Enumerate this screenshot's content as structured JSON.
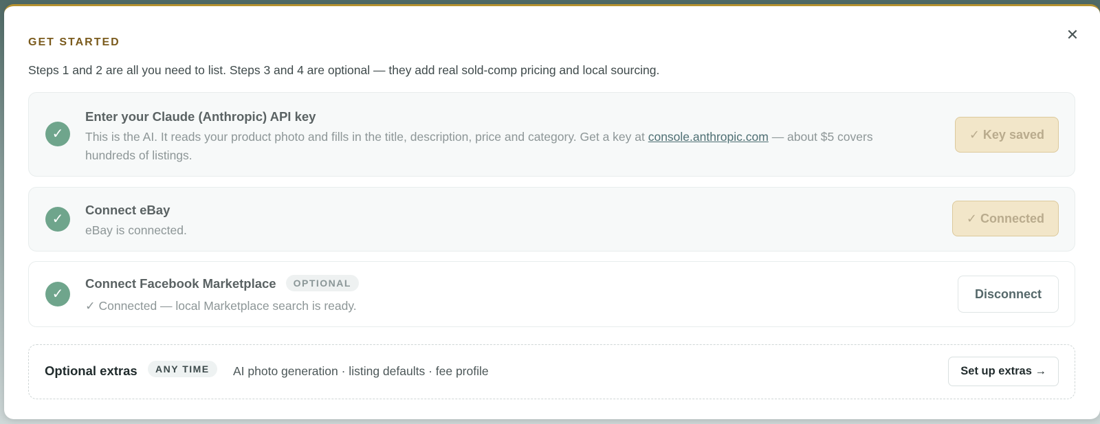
{
  "modal": {
    "eyebrow": "GET STARTED",
    "close_glyph": "✕",
    "intro": "Steps 1 and 2 are all you need to list. Steps 3 and 4 are optional — they add real sold-comp pricing and local sourcing."
  },
  "steps": [
    {
      "check_glyph": "✓",
      "title": "Enter your Claude (Anthropic) API key",
      "desc_before": "This is the AI. It reads your product photo and fills in the title, description, price and category. Get a key at ",
      "link": "console.anthropic.com",
      "desc_after": " — about $5 covers hundreds of listings.",
      "button": "✓ Key saved",
      "status": "done"
    },
    {
      "check_glyph": "✓",
      "title": "Connect eBay",
      "desc": "eBay is connected.",
      "button": "✓ Connected",
      "status": "done"
    },
    {
      "check_glyph": "✓",
      "title": "Connect Facebook Marketplace",
      "badge": "OPTIONAL",
      "desc": "✓ Connected — local Marketplace search is ready.",
      "button": "Disconnect",
      "status": "connected"
    }
  ],
  "extras": {
    "title": "Optional extras",
    "badge": "ANY TIME",
    "desc": "AI photo generation · listing defaults · fee profile",
    "button": "Set up extras →"
  },
  "colors": {
    "accent_gold": "#b5912f",
    "eyebrow": "#7a5a1c",
    "check_green": "#6fa58c",
    "done_button_bg": "#f2e6c9"
  }
}
